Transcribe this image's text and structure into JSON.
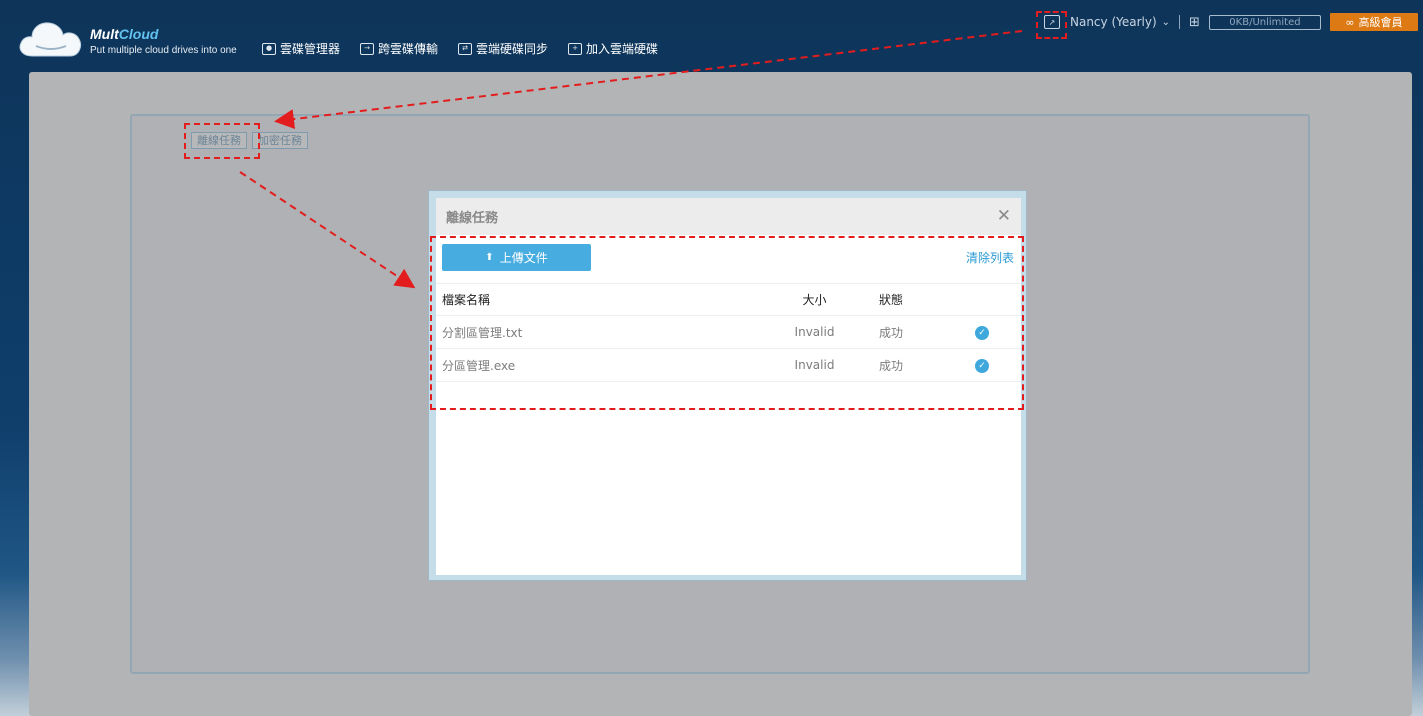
{
  "brand": {
    "name_part1": "Mult",
    "name_part2": "Cloud",
    "tagline": "Put multiple cloud drives into one",
    "accent_color": "#62c2ef"
  },
  "nav": [
    {
      "label": "雲碟管理器",
      "icon": "drive-manager-icon"
    },
    {
      "label": "跨雲碟傳輸",
      "icon": "transfer-icon"
    },
    {
      "label": "雲端硬碟同步",
      "icon": "sync-icon"
    },
    {
      "label": "加入雲端硬碟",
      "icon": "add-drive-icon"
    }
  ],
  "user": {
    "name": "Nancy (Yearly)",
    "storage": "0KB/Unlimited",
    "premium_label": "高級會員",
    "premium_color": "#dd7a14"
  },
  "task_tabs": [
    "離線任務",
    "加密任務"
  ],
  "modal": {
    "title": "離線任務",
    "upload_label": "上傳文件",
    "clear_label": "清除列表",
    "columns": [
      "檔案名稱",
      "大小",
      "狀態",
      ""
    ],
    "rows": [
      {
        "name": "分割區管理.txt",
        "size": "Invalid",
        "status": "成功"
      },
      {
        "name": "分區管理.exe",
        "size": "Invalid",
        "status": "成功"
      }
    ]
  },
  "annotation_color": "#e31d1d"
}
